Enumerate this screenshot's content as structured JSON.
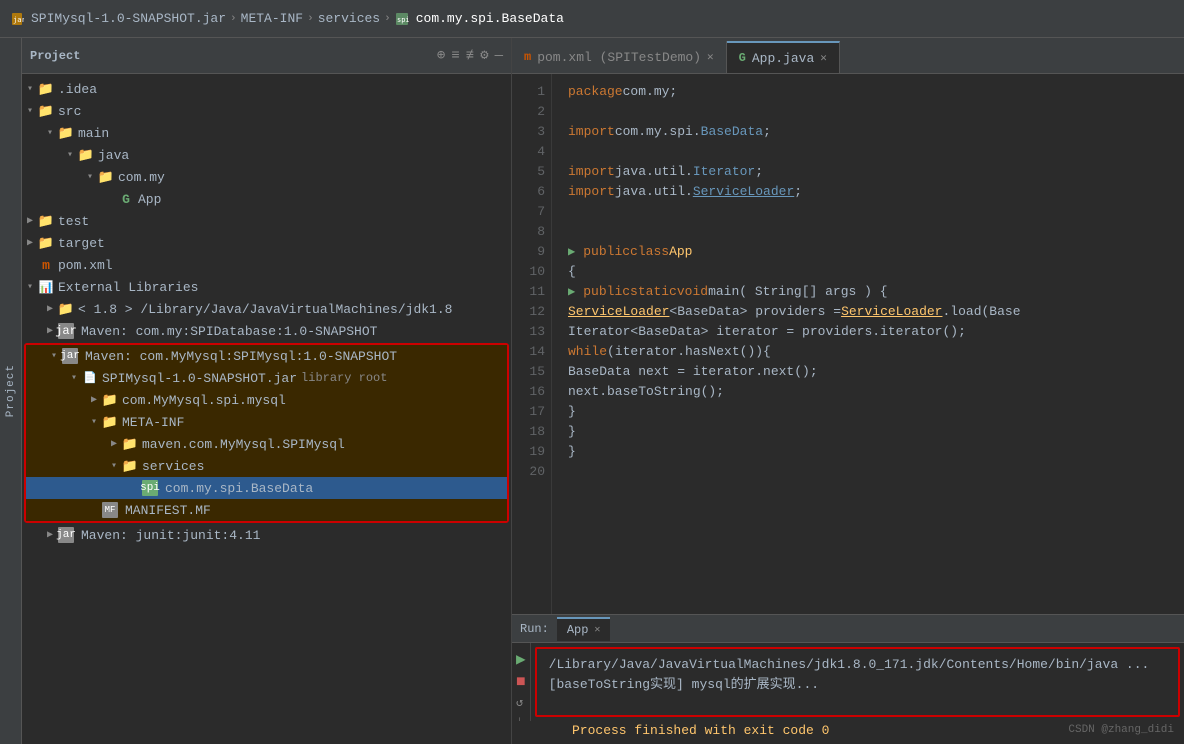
{
  "titlebar": {
    "breadcrumbs": [
      {
        "label": "SPIMysql-1.0-SNAPSHOT.jar",
        "icon": "jar"
      },
      {
        "label": "META-INF",
        "icon": "folder"
      },
      {
        "label": "services",
        "icon": "folder"
      },
      {
        "label": "com.my.spi.BaseData",
        "icon": "spi-file"
      }
    ]
  },
  "sidebar": {
    "title": "Project",
    "tools": [
      "⊕",
      "≡",
      "≢",
      "⚙",
      "—"
    ],
    "tree": [
      {
        "id": 1,
        "indent": 0,
        "arrow": "▾",
        "icon": "folder",
        "label": ".idea",
        "type": "folder"
      },
      {
        "id": 2,
        "indent": 0,
        "arrow": "▾",
        "icon": "folder",
        "label": "src",
        "type": "folder"
      },
      {
        "id": 3,
        "indent": 1,
        "arrow": "▾",
        "icon": "folder",
        "label": "main",
        "type": "folder"
      },
      {
        "id": 4,
        "indent": 2,
        "arrow": "▾",
        "icon": "folder",
        "label": "java",
        "type": "folder"
      },
      {
        "id": 5,
        "indent": 3,
        "arrow": "▾",
        "icon": "folder",
        "label": "com.my",
        "type": "folder"
      },
      {
        "id": 6,
        "indent": 4,
        "arrow": "",
        "icon": "java",
        "label": "App",
        "type": "java"
      },
      {
        "id": 7,
        "indent": 0,
        "arrow": "▶",
        "icon": "folder",
        "label": "test",
        "type": "folder"
      },
      {
        "id": 8,
        "indent": 0,
        "arrow": "▶",
        "icon": "folder-orange",
        "label": "target",
        "type": "folder"
      },
      {
        "id": 9,
        "indent": 0,
        "arrow": "",
        "icon": "xml",
        "label": "pom.xml",
        "type": "xml"
      },
      {
        "id": 10,
        "indent": 0,
        "arrow": "▾",
        "icon": "folder",
        "label": "External Libraries",
        "type": "folder"
      },
      {
        "id": 11,
        "indent": 1,
        "arrow": "▶",
        "icon": "folder",
        "label": "< 1.8 > /Library/Java/JavaVirtualMachines/jdk1.8",
        "type": "folder"
      },
      {
        "id": 12,
        "indent": 1,
        "arrow": "▶",
        "icon": "jar",
        "label": "Maven: com.my:SPIDatabase:1.0-SNAPSHOT",
        "type": "jar"
      },
      {
        "id": 13,
        "indent": 1,
        "arrow": "▾",
        "icon": "jar",
        "label": "Maven: com.MyMysql:SPIMysql:1.0-SNAPSHOT",
        "type": "jar",
        "highlighted": true
      },
      {
        "id": 14,
        "indent": 2,
        "arrow": "▾",
        "icon": "jar-file",
        "label": "SPIMysql-1.0-SNAPSHOT.jar",
        "sublabel": " library root",
        "type": "jar-file",
        "highlighted": true
      },
      {
        "id": 15,
        "indent": 3,
        "arrow": "▶",
        "icon": "folder",
        "label": "com.MyMysql.spi.mysql",
        "type": "folder",
        "highlighted": true
      },
      {
        "id": 16,
        "indent": 3,
        "arrow": "▾",
        "icon": "folder",
        "label": "META-INF",
        "type": "folder",
        "highlighted": true
      },
      {
        "id": 17,
        "indent": 4,
        "arrow": "▶",
        "icon": "folder",
        "label": "maven.com.MyMysql.SPIMysql",
        "type": "folder",
        "highlighted": true
      },
      {
        "id": 18,
        "indent": 4,
        "arrow": "▾",
        "icon": "folder",
        "label": "services",
        "type": "folder",
        "highlighted": true
      },
      {
        "id": 19,
        "indent": 5,
        "arrow": "",
        "icon": "spi-file",
        "label": "com.my.spi.BaseData",
        "type": "spi",
        "selected": true
      },
      {
        "id": 20,
        "indent": 3,
        "arrow": "",
        "icon": "mf",
        "label": "MANIFEST.MF",
        "type": "mf",
        "highlighted": true
      },
      {
        "id": 21,
        "indent": 1,
        "arrow": "▶",
        "icon": "jar",
        "label": "Maven: junit:junit:4.11",
        "type": "jar"
      }
    ]
  },
  "editor": {
    "tabs": [
      {
        "label": "pom.xml (SPITestDemo)",
        "icon": "m",
        "active": false,
        "closable": true
      },
      {
        "label": "App.java",
        "icon": "g",
        "active": true,
        "closable": true
      }
    ],
    "lines": [
      {
        "num": 1,
        "tokens": [
          {
            "text": "package ",
            "cls": "kw"
          },
          {
            "text": "com.my",
            "cls": "pkg"
          },
          {
            "text": ";",
            "cls": "type"
          }
        ]
      },
      {
        "num": 2,
        "tokens": []
      },
      {
        "num": 3,
        "tokens": [
          {
            "text": "import ",
            "cls": "kw"
          },
          {
            "text": "com.my.spi.",
            "cls": "pkg"
          },
          {
            "text": "BaseData",
            "cls": "pkg2"
          },
          {
            "text": ";",
            "cls": "type"
          }
        ]
      },
      {
        "num": 4,
        "tokens": []
      },
      {
        "num": 5,
        "tokens": [
          {
            "text": "import ",
            "cls": "kw"
          },
          {
            "text": "java.util.",
            "cls": "pkg"
          },
          {
            "text": "Iterator",
            "cls": "pkg2"
          },
          {
            "text": ";",
            "cls": "type"
          }
        ]
      },
      {
        "num": 6,
        "tokens": [
          {
            "text": "import ",
            "cls": "kw"
          },
          {
            "text": "java.util.",
            "cls": "pkg"
          },
          {
            "text": "ServiceLoader",
            "cls": "underline pkg2"
          },
          {
            "text": ";",
            "cls": "type"
          }
        ]
      },
      {
        "num": 7,
        "tokens": []
      },
      {
        "num": 8,
        "tokens": []
      },
      {
        "num": 9,
        "tokens": [
          {
            "text": "public ",
            "cls": "kw"
          },
          {
            "text": "class ",
            "cls": "kw"
          },
          {
            "text": "App ",
            "cls": "cls2"
          }
        ],
        "runnable": true
      },
      {
        "num": 10,
        "tokens": [
          {
            "text": "{",
            "cls": "type"
          }
        ]
      },
      {
        "num": 11,
        "tokens": [
          {
            "text": "    public ",
            "cls": "kw"
          },
          {
            "text": "static ",
            "cls": "kw"
          },
          {
            "text": "void ",
            "cls": "kw"
          },
          {
            "text": "main",
            "cls": "type"
          },
          {
            "text": "( String[] args ) {",
            "cls": "type"
          }
        ],
        "runnable": true
      },
      {
        "num": 12,
        "tokens": [
          {
            "text": "        ",
            "cls": "type"
          },
          {
            "text": "ServiceLoader",
            "cls": "cls2 underline"
          },
          {
            "text": "<BaseData> providers = ",
            "cls": "type"
          },
          {
            "text": "ServiceLoader",
            "cls": "cls2 underline"
          },
          {
            "text": ".load(Base",
            "cls": "type"
          }
        ]
      },
      {
        "num": 13,
        "tokens": [
          {
            "text": "        Iterator<BaseData> iterator = providers.iterator();",
            "cls": "type"
          }
        ]
      },
      {
        "num": 14,
        "tokens": [
          {
            "text": "        ",
            "cls": "type"
          },
          {
            "text": "while",
            "cls": "kw"
          },
          {
            "text": "(iterator.hasNext()){",
            "cls": "type"
          }
        ]
      },
      {
        "num": 15,
        "tokens": [
          {
            "text": "            BaseData next = iterator.next();",
            "cls": "type"
          }
        ]
      },
      {
        "num": 16,
        "tokens": [
          {
            "text": "            next.baseToString();",
            "cls": "type"
          }
        ]
      },
      {
        "num": 17,
        "tokens": [
          {
            "text": "        }",
            "cls": "type"
          }
        ]
      },
      {
        "num": 18,
        "tokens": [
          {
            "text": "    }",
            "cls": "type"
          }
        ]
      },
      {
        "num": 19,
        "tokens": [
          {
            "text": "}",
            "cls": "type"
          }
        ]
      },
      {
        "num": 20,
        "tokens": []
      }
    ]
  },
  "run_panel": {
    "label": "Run:",
    "tab_label": "App",
    "output_lines": [
      "/Library/Java/JavaVirtualMachines/jdk1.8.0_171.jdk/Contents/Home/bin/java ...",
      "[baseToString实现] mysql的扩展实现..."
    ],
    "exit_line": "Process finished with exit code 0"
  },
  "watermark": "CSDN @zhang_didi"
}
